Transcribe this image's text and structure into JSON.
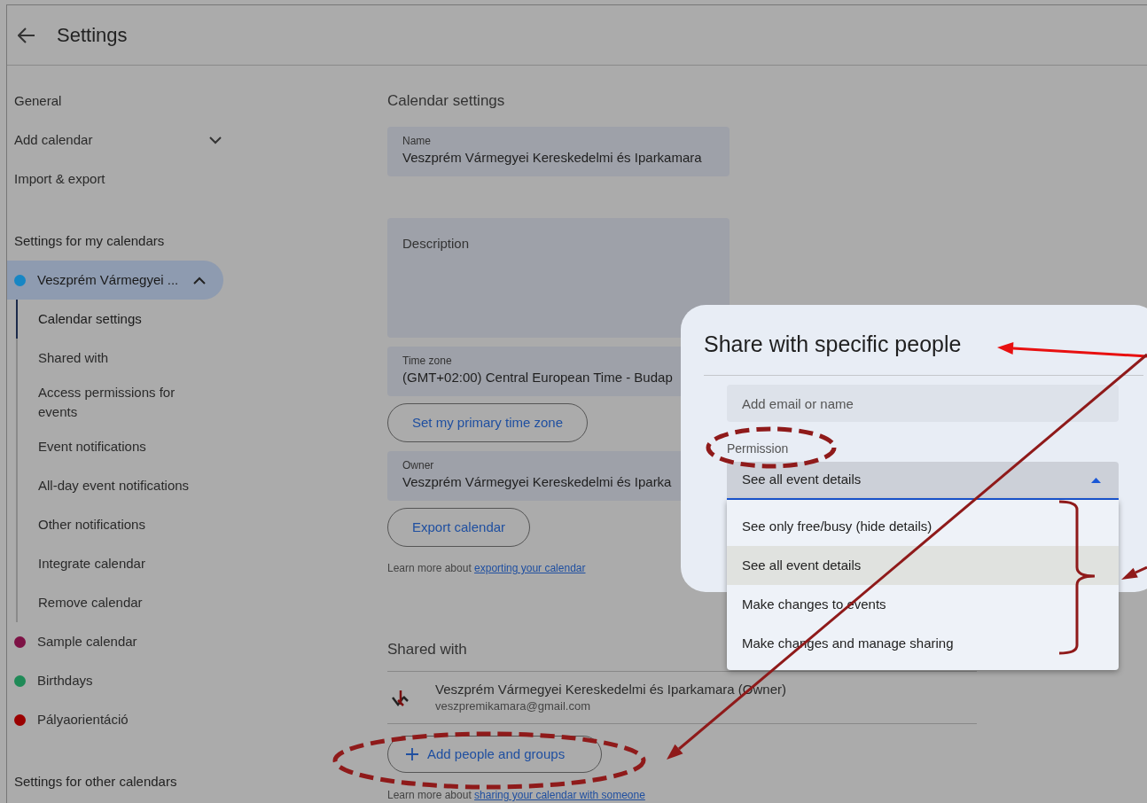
{
  "header": {
    "title": "Settings"
  },
  "sidebar": {
    "items": [
      {
        "label": "General",
        "kind": "link"
      },
      {
        "label": "Add calendar",
        "kind": "expandable",
        "expanded": false
      },
      {
        "label": "Import & export",
        "kind": "link"
      }
    ],
    "my_calendars_heading": "Settings for my calendars",
    "calendars": [
      {
        "name": "Veszprém Vármegyei ...",
        "color": "#1786c4",
        "selected": true,
        "expanded": true,
        "children": [
          {
            "label": "Calendar settings",
            "selected": true
          },
          {
            "label": "Shared with",
            "selected": false
          },
          {
            "label": "Access permissions for events",
            "selected": false
          },
          {
            "label": "Event notifications",
            "selected": false
          },
          {
            "label": "All-day event notifications",
            "selected": false
          },
          {
            "label": "Other notifications",
            "selected": false
          },
          {
            "label": "Integrate calendar",
            "selected": false
          },
          {
            "label": "Remove calendar",
            "selected": false
          }
        ]
      },
      {
        "name": "Sample calendar",
        "color": "#7d1245",
        "selected": false
      },
      {
        "name": "Birthdays",
        "color": "#1f8a57",
        "selected": false
      },
      {
        "name": "Pályaorientáció",
        "color": "#9a0000",
        "selected": false
      }
    ],
    "other_calendars_heading": "Settings for other calendars"
  },
  "main": {
    "section_title": "Calendar settings",
    "items": [
      {
        "kind": "field",
        "label": "Name",
        "value": "Veszprém Vármegyei Kereskedelmi és Iparkamara"
      },
      {
        "kind": "textarea",
        "label": "Description"
      },
      {
        "kind": "field",
        "label": "Time zone",
        "value": "(GMT+02:00) Central European Time - Budap"
      },
      {
        "kind": "button",
        "label": "Set my primary time zone"
      },
      {
        "kind": "field",
        "label": "Owner",
        "value": "Veszprém Vármegyei Kereskedelmi és Iparka"
      },
      {
        "kind": "button",
        "label": "Export calendar"
      },
      {
        "kind": "note",
        "text": "Learn more about ",
        "link": "exporting your calendar"
      }
    ]
  },
  "shared": {
    "heading": "Shared with",
    "members": [
      {
        "name": "Veszprém Vármegyei Kereskedelmi és Iparkamara (Owner)",
        "email": "veszpremikamara@gmail.com"
      }
    ],
    "add_button": "Add people and groups",
    "note": {
      "text": "Learn more about ",
      "link": "sharing your calendar with someone"
    }
  },
  "dialog": {
    "title": "Share with specific people",
    "input": {
      "placeholder": "Add email or name"
    },
    "permission": {
      "label": "Permission",
      "value": "See all event details",
      "expanded": true,
      "options": [
        {
          "label": "See only free/busy (hide details)",
          "selected": false
        },
        {
          "label": "See all event details",
          "selected": true
        },
        {
          "label": "Make changes to events",
          "selected": false
        },
        {
          "label": "Make changes and manage sharing",
          "selected": false
        }
      ]
    }
  }
}
